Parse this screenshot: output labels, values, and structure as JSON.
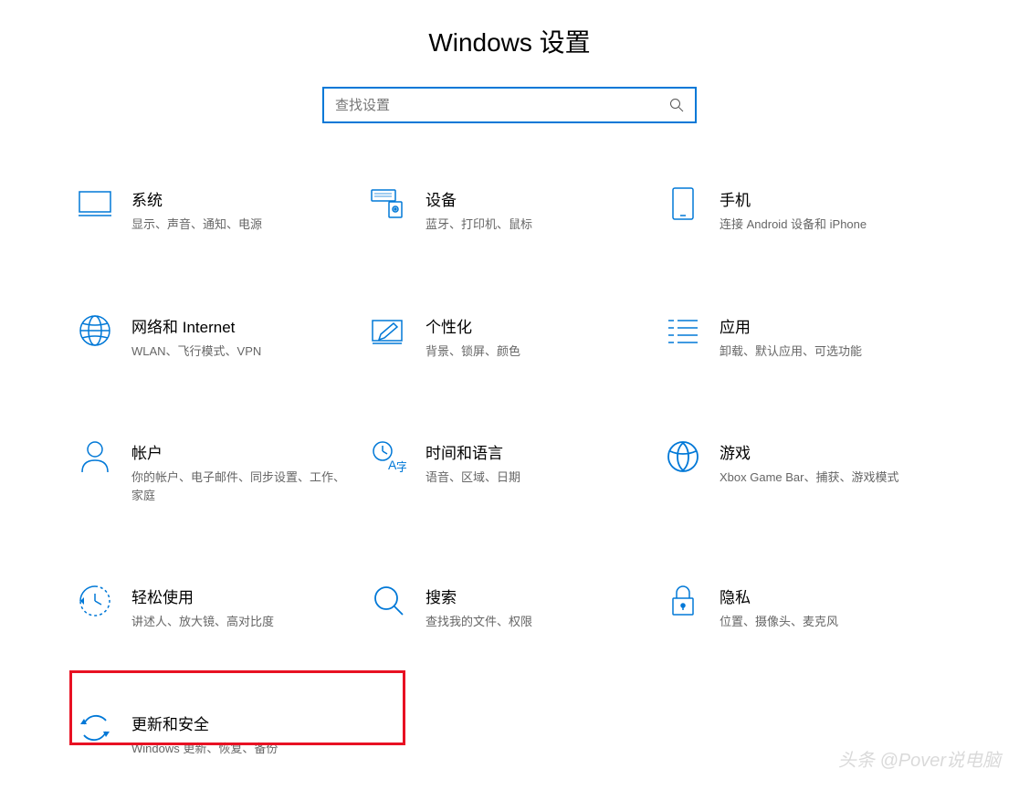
{
  "header": {
    "title": "Windows 设置"
  },
  "search": {
    "placeholder": "查找设置"
  },
  "tiles": {
    "system": {
      "title": "系统",
      "desc": "显示、声音、通知、电源"
    },
    "devices": {
      "title": "设备",
      "desc": "蓝牙、打印机、鼠标"
    },
    "phone": {
      "title": "手机",
      "desc": "连接 Android 设备和 iPhone"
    },
    "network": {
      "title": "网络和 Internet",
      "desc": "WLAN、飞行模式、VPN"
    },
    "personalization": {
      "title": "个性化",
      "desc": "背景、锁屏、颜色"
    },
    "apps": {
      "title": "应用",
      "desc": "卸载、默认应用、可选功能"
    },
    "accounts": {
      "title": "帐户",
      "desc": "你的帐户、电子邮件、同步设置、工作、家庭"
    },
    "time": {
      "title": "时间和语言",
      "desc": "语音、区域、日期"
    },
    "gaming": {
      "title": "游戏",
      "desc": "Xbox Game Bar、捕获、游戏模式"
    },
    "ease": {
      "title": "轻松使用",
      "desc": "讲述人、放大镜、高对比度"
    },
    "searchTile": {
      "title": "搜索",
      "desc": "查找我的文件、权限"
    },
    "privacy": {
      "title": "隐私",
      "desc": "位置、摄像头、麦克风"
    },
    "update": {
      "title": "更新和安全",
      "desc": "Windows 更新、恢复、备份"
    }
  },
  "watermark": "头条 @Pover说电脑"
}
